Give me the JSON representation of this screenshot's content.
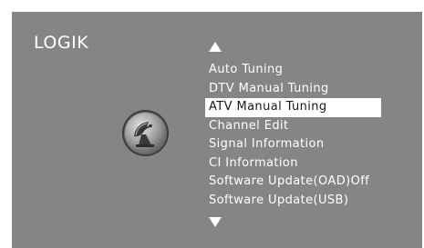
{
  "brand": {
    "logo_text": "LOGIK"
  },
  "menu": {
    "scroll_up_icon": "triangle-up",
    "scroll_down_icon": "triangle-down",
    "emblem_icon": "satellite-dish-icon",
    "selected_index": 2,
    "items": [
      {
        "label": "Auto Tuning"
      },
      {
        "label": "DTV Manual Tuning"
      },
      {
        "label": "ATV Manual Tuning"
      },
      {
        "label": "Channel Edit"
      },
      {
        "label": "Signal Information"
      },
      {
        "label": "CI Information"
      },
      {
        "label": "Software Update(OAD)Off"
      },
      {
        "label": "Software Update(USB)"
      }
    ]
  },
  "colors": {
    "background": "#858585",
    "text": "#ffffff",
    "highlight_bg": "#ffffff",
    "highlight_text": "#1a1a1a"
  }
}
